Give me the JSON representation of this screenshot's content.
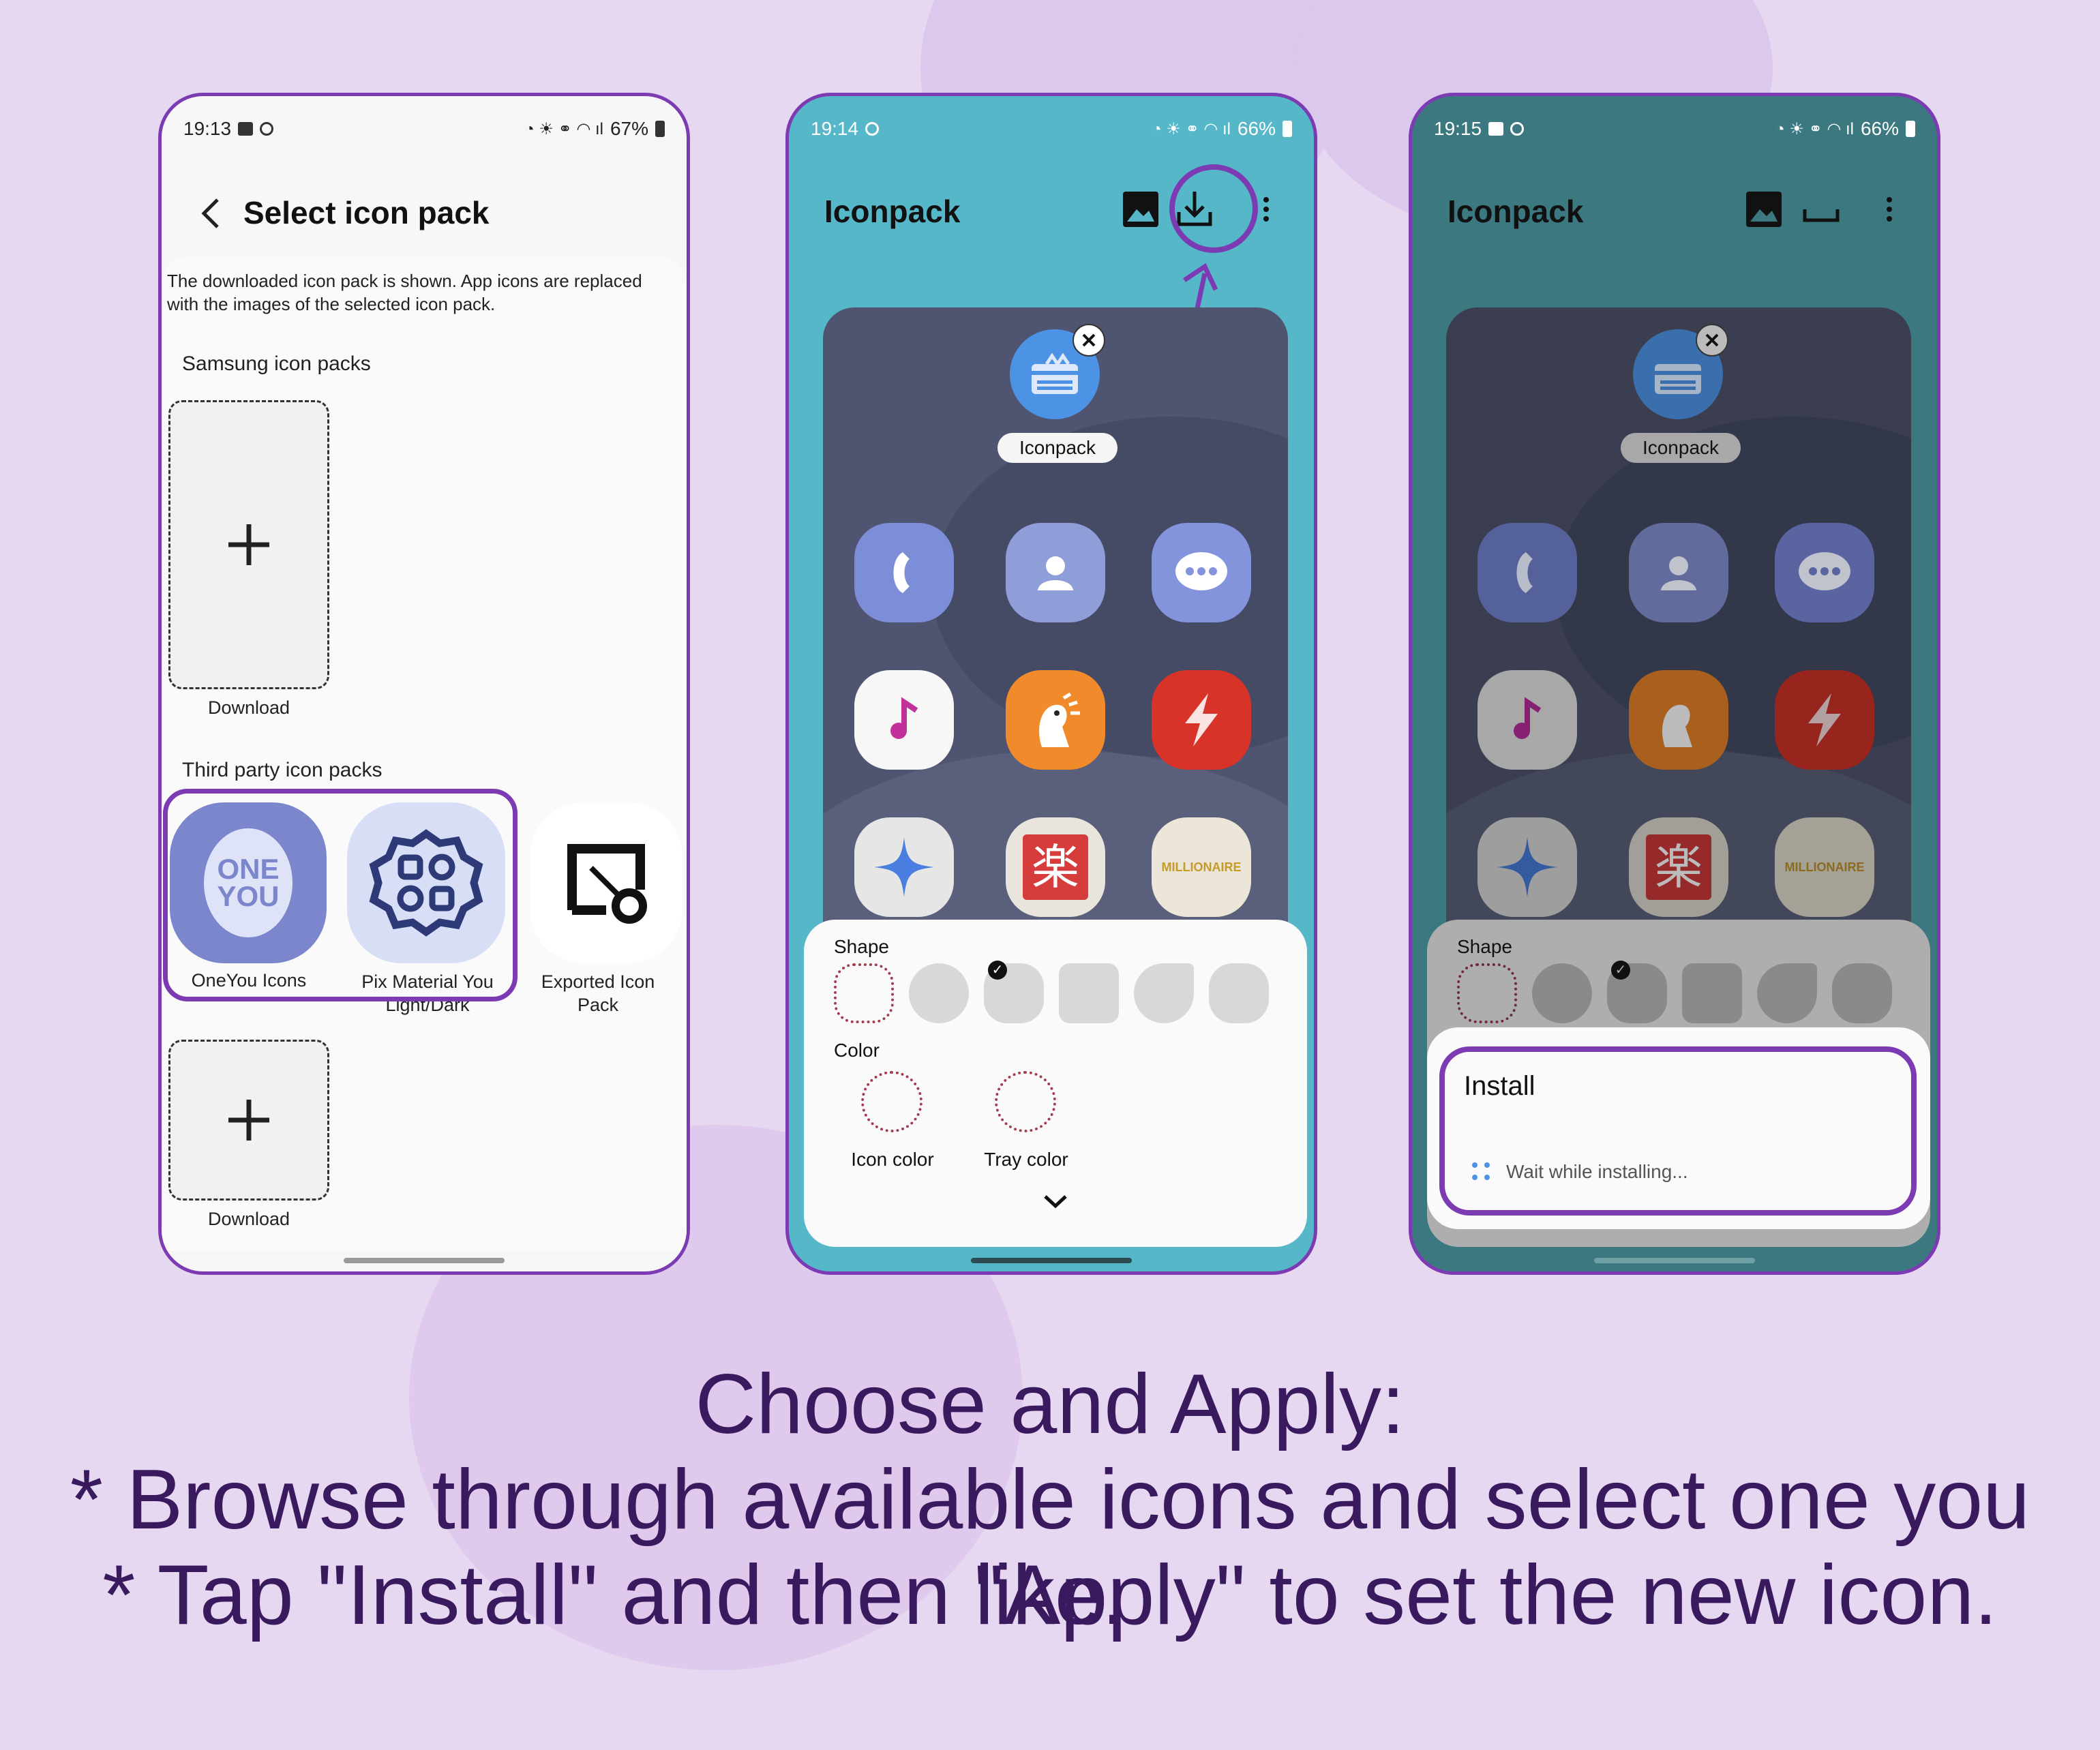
{
  "colors": {
    "accent": "#7d3bb3",
    "caption": "#3a1a5e",
    "teal": "#56b7c9",
    "dark_teal": "#3b7880"
  },
  "phone1": {
    "status": {
      "time": "19:13",
      "battery": "67%"
    },
    "title": "Select icon pack",
    "description": "The downloaded icon pack is shown. App icons are replaced with the images of the selected icon pack.",
    "samsung_section": "Samsung icon packs",
    "download_label": "Download",
    "third_party_section": "Third party icon packs",
    "packs": [
      {
        "label": "OneYou Icons",
        "logo": "ONE YOU"
      },
      {
        "label": "Pix Material You Light/Dark"
      },
      {
        "label": "Exported Icon Pack"
      }
    ],
    "download_label_2": "Download"
  },
  "phone2": {
    "status": {
      "time": "19:14",
      "battery": "66%"
    },
    "title": "Iconpack",
    "preview_label": "Iconpack",
    "shape_label": "Shape",
    "color_label": "Color",
    "icon_color_label": "Icon color",
    "tray_color_label": "Tray color",
    "app_icons": [
      "phone",
      "contacts",
      "messages",
      "music",
      "rooster",
      "bolt",
      "sparkle",
      "raku",
      "millionaire"
    ],
    "millionaire_text": "MILLIONAIRE"
  },
  "phone3": {
    "status": {
      "time": "19:15",
      "battery": "66%"
    },
    "title": "Iconpack",
    "preview_label": "Iconpack",
    "shape_label": "Shape",
    "install_title": "Install",
    "install_status": "Wait while installing...",
    "millionaire_text": "MILLIONAIRE"
  },
  "caption": {
    "line1": "Choose and Apply:",
    "line2": "* Browse through available icons and select one you like.",
    "line3": "* Tap \"Install\" and then \"Apply\" to set the new icon."
  }
}
